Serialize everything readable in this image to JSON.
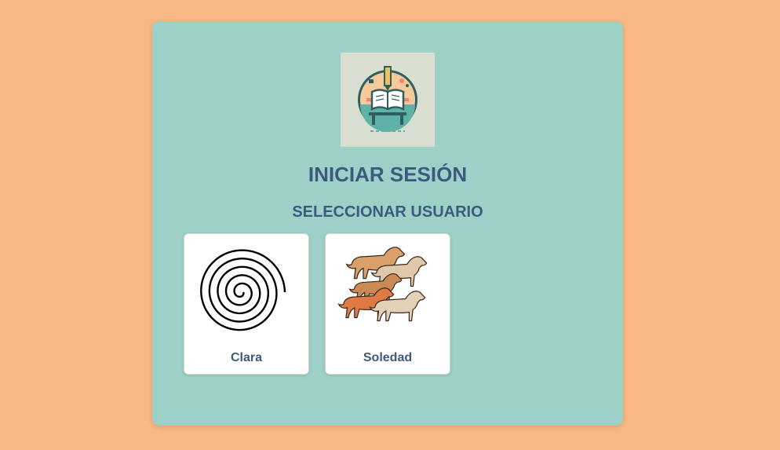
{
  "login": {
    "title": "INICIAR SESIÓN",
    "subtitle": "SELECCIONAR USUARIO"
  },
  "users": [
    {
      "name": "Clara",
      "picture_icon": "spiral-icon"
    },
    {
      "name": "Soledad",
      "picture_icon": "dogs-icon"
    }
  ],
  "colors": {
    "background": "#f8b784",
    "card": "#9dd1c8",
    "text": "#3b5b7e"
  }
}
